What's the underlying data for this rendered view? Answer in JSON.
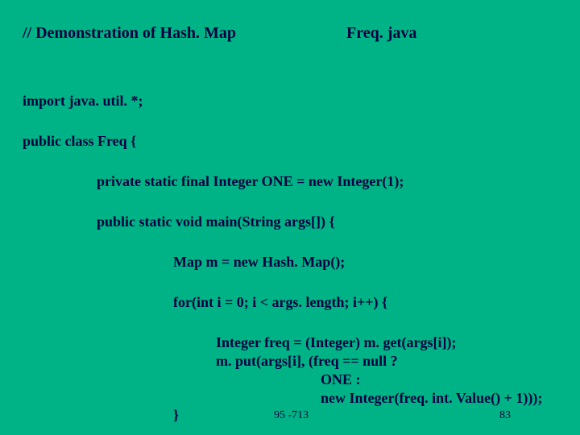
{
  "title_left": "// Demonstration of Hash. Map",
  "title_right": "Freq. java",
  "lines": {
    "import": "import java. util. *;",
    "class_decl": "public class Freq {",
    "one_decl": "private static final Integer ONE = new Integer(1);",
    "main_decl": "public static void main(String args[]) {",
    "map_decl": "Map m = new Hash. Map();",
    "for_decl": "for(int i = 0; i < args. length; i++) {",
    "freq_get": "Integer freq = (Integer) m. get(args[i]);",
    "put_call": "m. put(args[i], (freq == null ?",
    "one_branch": "ONE :",
    "new_int": "new Integer(freq. int. Value() + 1)));",
    "close_brace": "}"
  },
  "footer": {
    "left": "95 -713",
    "right": "83"
  }
}
